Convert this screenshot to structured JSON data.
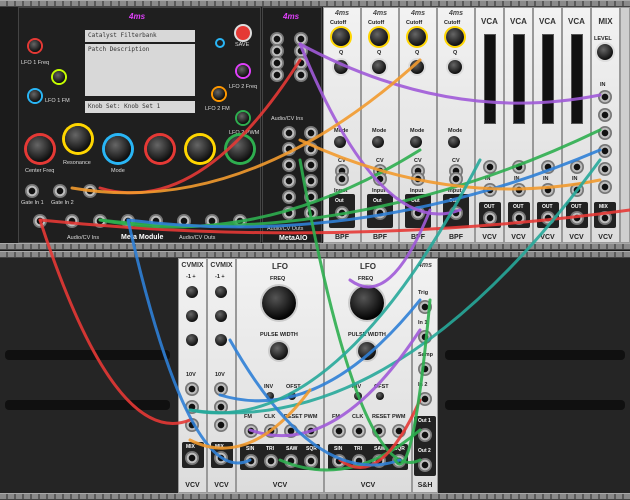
{
  "meta_module": {
    "patch_title": "Catalyst Filterbank",
    "patch_description": "Patch Description",
    "knob_set": "Knob Set: Knob Set 1",
    "save_label": "SAVE",
    "labels": {
      "lfo1_freq": "LFO 1 Freq",
      "lfo1_fm": "LFO 1 FM",
      "lfo2_freq": "LFO 2 Freq",
      "lfo2_fm": "LFO 2 FM",
      "lfo2_pwm": "LFO 2 PWM",
      "resonance": "Resonance",
      "mode": "Mode",
      "center_freq": "Center Freq",
      "gate_in_1": "Gate In 1",
      "gate_in_2": "Gate In 2",
      "audio_cv_ins": "Audio/CV Ins",
      "audio_cv_outs": "Audio/CV Outs",
      "footer": "Meta Module"
    },
    "knob_letters": [
      "A",
      "B",
      "C",
      "D",
      "E",
      "F"
    ]
  },
  "meta_aio": {
    "audio_cv_ins": "Audio/CV Ins",
    "audio_cv_outs": "Audio/CV Outs",
    "footer": "MetaAIO"
  },
  "bpf": {
    "labels": [
      "Cutoff",
      "Q",
      "Mode",
      "CV",
      "Input",
      "Out"
    ],
    "footer": "BPF"
  },
  "vca": {
    "title": "VCA",
    "labels": [
      "IN",
      "OUT"
    ],
    "footer": "VCV"
  },
  "mix": {
    "title": "MIX",
    "level": "LEVEL",
    "in": "IN",
    "out": "MIX",
    "footer": "VCV"
  },
  "cvmix": {
    "title": "CVMIX",
    "range": "-1 +",
    "out": "MIX",
    "footer": "VCV"
  },
  "lfo": {
    "title": "LFO",
    "freq": "FREQ",
    "pulse_width": "PULSE WIDTH",
    "inv": "INV",
    "ofst": "OFST",
    "ten_v": "10V",
    "inputs": [
      "FM",
      "CLK",
      "RESET",
      "PWM"
    ],
    "outputs": [
      "SIN",
      "TRI",
      "SAW",
      "SQR"
    ],
    "footer": "VCV"
  },
  "sh": {
    "labels": [
      "Trig",
      "In 1",
      "Samp",
      "In 2",
      "Out 1",
      "Out 2"
    ],
    "footer": "S&H"
  },
  "brand_logo": "4ms",
  "colors": {
    "cable_red": "#e53935",
    "cable_green": "#2eae4f",
    "cable_blue": "#2f7fd6",
    "cable_purple": "#a05ad8",
    "cable_orange": "#f29a2e",
    "cable_teal": "#27a99a"
  }
}
